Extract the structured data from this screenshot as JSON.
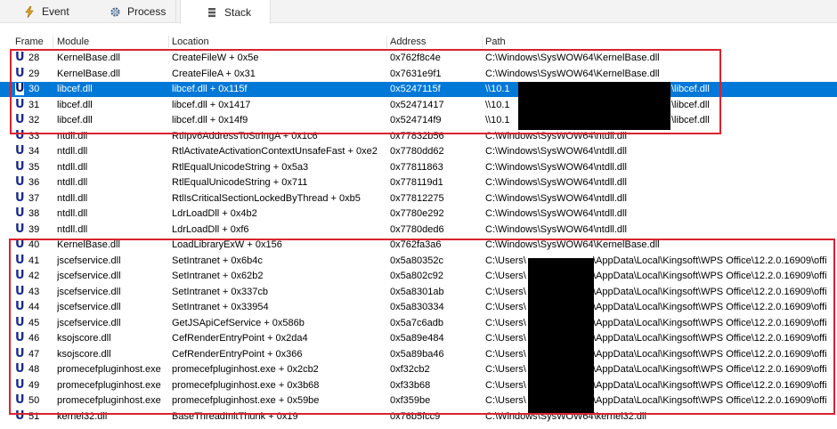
{
  "tabs": [
    {
      "label": "Event",
      "icon": "lightning-icon"
    },
    {
      "label": "Process",
      "icon": "gear-icon"
    },
    {
      "label": "Stack",
      "icon": "stack-icon",
      "active": true
    }
  ],
  "columns": [
    "Frame",
    "Module",
    "Location",
    "Address",
    "Path"
  ],
  "rows": [
    {
      "frame": "28",
      "module": "KernelBase.dll",
      "location": "CreateFileW + 0x5e",
      "address": "0x762f8c4e",
      "path": "C:\\Windows\\SysWOW64\\KernelBase.dll"
    },
    {
      "frame": "29",
      "module": "KernelBase.dll",
      "location": "CreateFileA + 0x31",
      "address": "0x7631e9f1",
      "path": "C:\\Windows\\SysWOW64\\KernelBase.dll"
    },
    {
      "frame": "30",
      "module": "libcef.dll",
      "location": "libcef.dll + 0x115f",
      "address": "0x5247115f",
      "path": "\\\\10.1",
      "path_tail": "\\libcef.dll",
      "selected": true
    },
    {
      "frame": "31",
      "module": "libcef.dll",
      "location": "libcef.dll + 0x1417",
      "address": "0x52471417",
      "path": "\\\\10.1",
      "path_tail": "\\libcef.dll"
    },
    {
      "frame": "32",
      "module": "libcef.dll",
      "location": "libcef.dll + 0x14f9",
      "address": "0x524714f9",
      "path": "\\\\10.1",
      "path_tail": "\\libcef.dll"
    },
    {
      "frame": "33",
      "module": "ntdll.dll",
      "location": "RtlIpv6AddressToStringA + 0x1c6",
      "address": "0x77832b56",
      "path": "C:\\Windows\\SysWOW64\\ntdll.dll"
    },
    {
      "frame": "34",
      "module": "ntdll.dll",
      "location": "RtlActivateActivationContextUnsafeFast + 0xe2",
      "address": "0x7780dd62",
      "path": "C:\\Windows\\SysWOW64\\ntdll.dll"
    },
    {
      "frame": "35",
      "module": "ntdll.dll",
      "location": "RtlEqualUnicodeString + 0x5a3",
      "address": "0x77811863",
      "path": "C:\\Windows\\SysWOW64\\ntdll.dll"
    },
    {
      "frame": "36",
      "module": "ntdll.dll",
      "location": "RtlEqualUnicodeString + 0x711",
      "address": "0x778119d1",
      "path": "C:\\Windows\\SysWOW64\\ntdll.dll"
    },
    {
      "frame": "37",
      "module": "ntdll.dll",
      "location": "RtlIsCriticalSectionLockedByThread + 0xb5",
      "address": "0x77812275",
      "path": "C:\\Windows\\SysWOW64\\ntdll.dll"
    },
    {
      "frame": "38",
      "module": "ntdll.dll",
      "location": "LdrLoadDll + 0x4b2",
      "address": "0x7780e292",
      "path": "C:\\Windows\\SysWOW64\\ntdll.dll"
    },
    {
      "frame": "39",
      "module": "ntdll.dll",
      "location": "LdrLoadDll + 0xf6",
      "address": "0x7780ded6",
      "path": "C:\\Windows\\SysWOW64\\ntdll.dll"
    },
    {
      "frame": "40",
      "module": "KernelBase.dll",
      "location": "LoadLibraryExW + 0x156",
      "address": "0x762fa3a6",
      "path": "C:\\Windows\\SysWOW64\\KernelBase.dll"
    },
    {
      "frame": "41",
      "module": "jscefservice.dll",
      "location": "SetIntranet + 0x6b4c",
      "address": "0x5a80352c",
      "path": "C:\\Users\\",
      "path_tail": "\\AppData\\Local\\Kingsoft\\WPS Office\\12.2.0.16909\\offi"
    },
    {
      "frame": "42",
      "module": "jscefservice.dll",
      "location": "SetIntranet + 0x62b2",
      "address": "0x5a802c92",
      "path": "C:\\Users\\",
      "path_tail": "\\AppData\\Local\\Kingsoft\\WPS Office\\12.2.0.16909\\offi"
    },
    {
      "frame": "43",
      "module": "jscefservice.dll",
      "location": "SetIntranet + 0x337cb",
      "address": "0x5a8301ab",
      "path": "C:\\Users\\",
      "path_tail": "\\AppData\\Local\\Kingsoft\\WPS Office\\12.2.0.16909\\offi"
    },
    {
      "frame": "44",
      "module": "jscefservice.dll",
      "location": "SetIntranet + 0x33954",
      "address": "0x5a830334",
      "path": "C:\\Users\\",
      "path_tail": "\\AppData\\Local\\Kingsoft\\WPS Office\\12.2.0.16909\\offi"
    },
    {
      "frame": "45",
      "module": "jscefservice.dll",
      "location": "GetJSApiCefService + 0x586b",
      "address": "0x5a7c6adb",
      "path": "C:\\Users\\",
      "path_tail": "\\AppData\\Local\\Kingsoft\\WPS Office\\12.2.0.16909\\offi"
    },
    {
      "frame": "46",
      "module": "ksojscore.dll",
      "location": "CefRenderEntryPoint + 0x2da4",
      "address": "0x5a89e484",
      "path": "C:\\Users\\",
      "path_tail": "\\AppData\\Local\\Kingsoft\\WPS Office\\12.2.0.16909\\offi"
    },
    {
      "frame": "47",
      "module": "ksojscore.dll",
      "location": "CefRenderEntryPoint + 0x366",
      "address": "0x5a89ba46",
      "path": "C:\\Users\\",
      "path_tail": "\\AppData\\Local\\Kingsoft\\WPS Office\\12.2.0.16909\\offi"
    },
    {
      "frame": "48",
      "module": "promecefpluginhost.exe",
      "location": "promecefpluginhost.exe + 0x2cb2",
      "address": "0xf32cb2",
      "path": "C:\\Users\\",
      "path_tail": "\\AppData\\Local\\Kingsoft\\WPS Office\\12.2.0.16909\\offi"
    },
    {
      "frame": "49",
      "module": "promecefpluginhost.exe",
      "location": "promecefpluginhost.exe + 0x3b68",
      "address": "0xf33b68",
      "path": "C:\\Users\\",
      "path_tail": "\\AppData\\Local\\Kingsoft\\WPS Office\\12.2.0.16909\\offi"
    },
    {
      "frame": "50",
      "module": "promecefpluginhost.exe",
      "location": "promecefpluginhost.exe + 0x59be",
      "address": "0xf359be",
      "path": "C:\\Users\\",
      "path_tail": "\\AppData\\Local\\Kingsoft\\WPS Office\\12.2.0.16909\\offi"
    },
    {
      "frame": "51",
      "module": "kernel32.dll",
      "location": "BaseThreadInitThunk + 0x19",
      "address": "0x76b5fcc9",
      "path": "C:\\Windows\\SysWOW64\\kernel32.dll"
    }
  ],
  "colors": {
    "selection": "#0078d7",
    "highlight_box": "#d9232e",
    "user_icon": "#1a2a8c"
  }
}
